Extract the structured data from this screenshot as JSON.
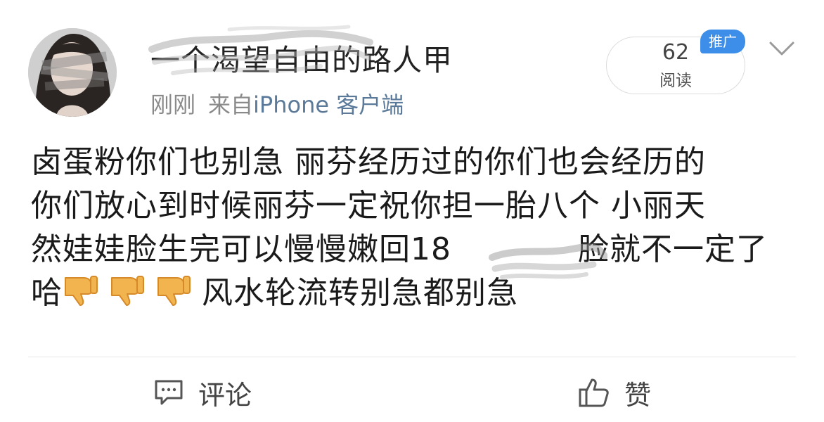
{
  "post": {
    "author_name": "一个渴望自由的路人甲",
    "timestamp": "刚刚",
    "source_prefix": "来自",
    "source_name": "iPhone 客户端",
    "read_count": "62",
    "read_label": "阅读",
    "promo_badge": "推广",
    "text_lines": [
      "卤蛋粉你们也别急 丽芬经历过的你们也会经历的",
      "你们放心到时候丽芬一定祝你担一胎八个 小丽天",
      "然娃娃脸生完可以慢慢嫩回18",
      "脸就不一定了",
      "哈",
      "风水轮流转别急都别急"
    ],
    "emoji": "thumbs-down-icon"
  },
  "actions": {
    "comment_label": "评论",
    "like_label": "赞"
  },
  "colors": {
    "accent": "#3d8ee8",
    "source_link": "#5b7a9a",
    "meta_gray": "#8a8a8a",
    "text": "#1a1a1a"
  }
}
